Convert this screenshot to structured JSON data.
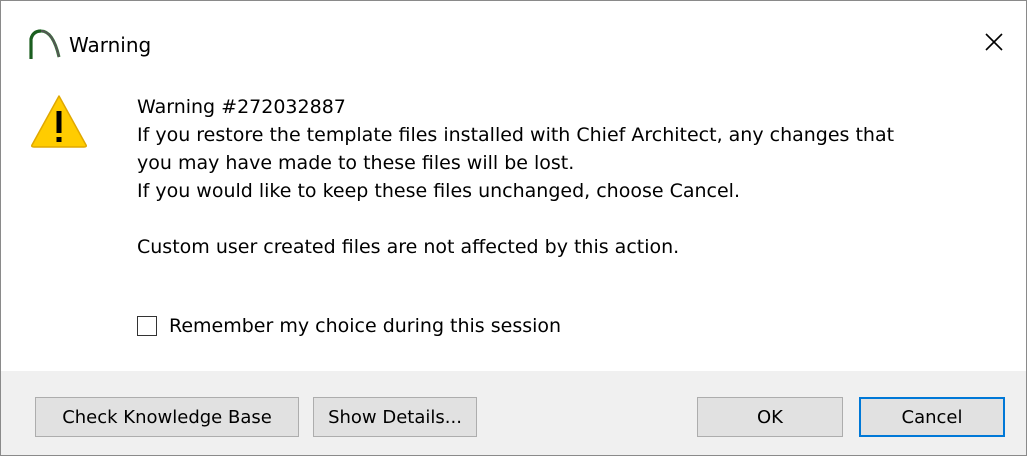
{
  "window": {
    "title": "Warning",
    "app_icon": "chief-architect-icon",
    "close_icon": "close-icon"
  },
  "message": {
    "icon": "warning-triangle-icon",
    "code": "Warning #272032887",
    "line1": "If you restore the template files installed with Chief Architect, any changes that",
    "line2": "you may have made to these files will be lost.",
    "line3": "If you would like to keep these files unchanged, choose Cancel.",
    "line4": "Custom user created files are not affected by this action."
  },
  "checkbox": {
    "label": "Remember my choice during this session",
    "checked": false
  },
  "buttons": {
    "knowledge_base": "Check Knowledge Base",
    "show_details": "Show Details...",
    "ok": "OK",
    "cancel": "Cancel"
  },
  "colors": {
    "warning_yellow": "#ffcc00",
    "focus_blue": "#0078d7",
    "footer_bg": "#f0f0f0",
    "button_bg": "#e1e1e1"
  }
}
